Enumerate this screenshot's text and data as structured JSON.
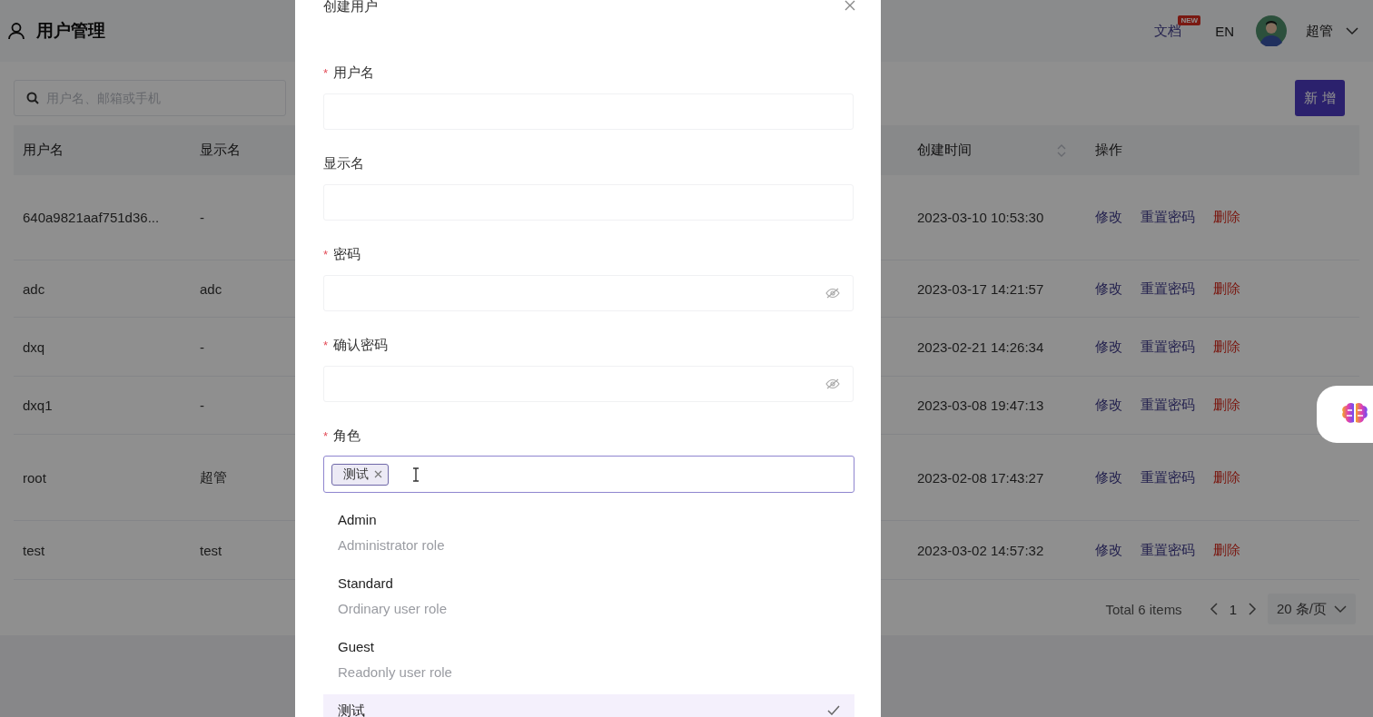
{
  "header": {
    "title": "用户管理",
    "docs_link": "文档",
    "docs_badge": "NEW",
    "language": "EN",
    "user_name": "超管"
  },
  "search": {
    "placeholder": "用户名、邮箱或手机"
  },
  "add_button": "新 增",
  "table": {
    "columns": [
      {
        "label": "用户名"
      },
      {
        "label": "显示名"
      },
      {
        "label": "创建时间",
        "sortable": true
      },
      {
        "label": "操作"
      }
    ],
    "rows": [
      {
        "username": "640a9821aaf751d36...",
        "display_name": "-",
        "created": "2023-03-10 10:53:30",
        "actions": [
          {
            "label": "修改",
            "kind": "link"
          },
          {
            "label": "重置密码",
            "kind": "link"
          },
          {
            "label": "删除",
            "kind": "danger"
          }
        ]
      },
      {
        "username": "adc",
        "display_name": "adc",
        "created": "2023-03-17 14:21:57",
        "actions": [
          {
            "label": "修改",
            "kind": "link"
          },
          {
            "label": "重置密码",
            "kind": "link"
          },
          {
            "label": "删除",
            "kind": "danger"
          }
        ]
      },
      {
        "username": "dxq",
        "display_name": "-",
        "created": "2023-02-21 14:26:34",
        "actions": [
          {
            "label": "修改",
            "kind": "link"
          },
          {
            "label": "重置密码",
            "kind": "link"
          },
          {
            "label": "删除",
            "kind": "danger"
          }
        ]
      },
      {
        "username": "dxq1",
        "display_name": "-",
        "created": "2023-03-08 19:47:13",
        "actions": [
          {
            "label": "修改",
            "kind": "link"
          },
          {
            "label": "重置密码",
            "kind": "link"
          },
          {
            "label": "删除",
            "kind": "danger"
          }
        ]
      },
      {
        "username": "root",
        "display_name": "超管",
        "created": "2023-02-08 17:43:27",
        "actions": [
          {
            "label": "修改",
            "kind": "link"
          },
          {
            "label": "重置密码",
            "kind": "link"
          },
          {
            "label": "删除",
            "kind": "danger"
          }
        ]
      },
      {
        "username": "test",
        "display_name": "test",
        "created": "2023-03-02 14:57:32",
        "actions": [
          {
            "label": "修改",
            "kind": "link"
          },
          {
            "label": "重置密码",
            "kind": "link"
          },
          {
            "label": "删除",
            "kind": "danger"
          }
        ]
      }
    ]
  },
  "pagination": {
    "total": "Total 6 items",
    "pages": [
      {
        "label": "1",
        "selected": true
      }
    ],
    "page_size": "20 条/页"
  },
  "modal": {
    "title": "创建用户",
    "fields": [
      {
        "label": "用户名",
        "required_mark": "*",
        "kind": "text"
      },
      {
        "label": "显示名",
        "kind": "text"
      },
      {
        "label": "密码",
        "required_mark": "*",
        "kind": "password"
      },
      {
        "label": "确认密码",
        "required_mark": "*",
        "kind": "password"
      },
      {
        "label": "角色",
        "required_mark": "*",
        "kind": "select",
        "focused": true,
        "tags": [
          "测试"
        ]
      }
    ],
    "role_options": [
      {
        "name": "Admin",
        "description": "Administrator role",
        "selected": false
      },
      {
        "name": "Standard",
        "description": "Ordinary user role",
        "selected": false
      },
      {
        "name": "Guest",
        "description": "Readonly user role",
        "selected": false
      },
      {
        "name": "测试",
        "selected": true
      }
    ]
  }
}
